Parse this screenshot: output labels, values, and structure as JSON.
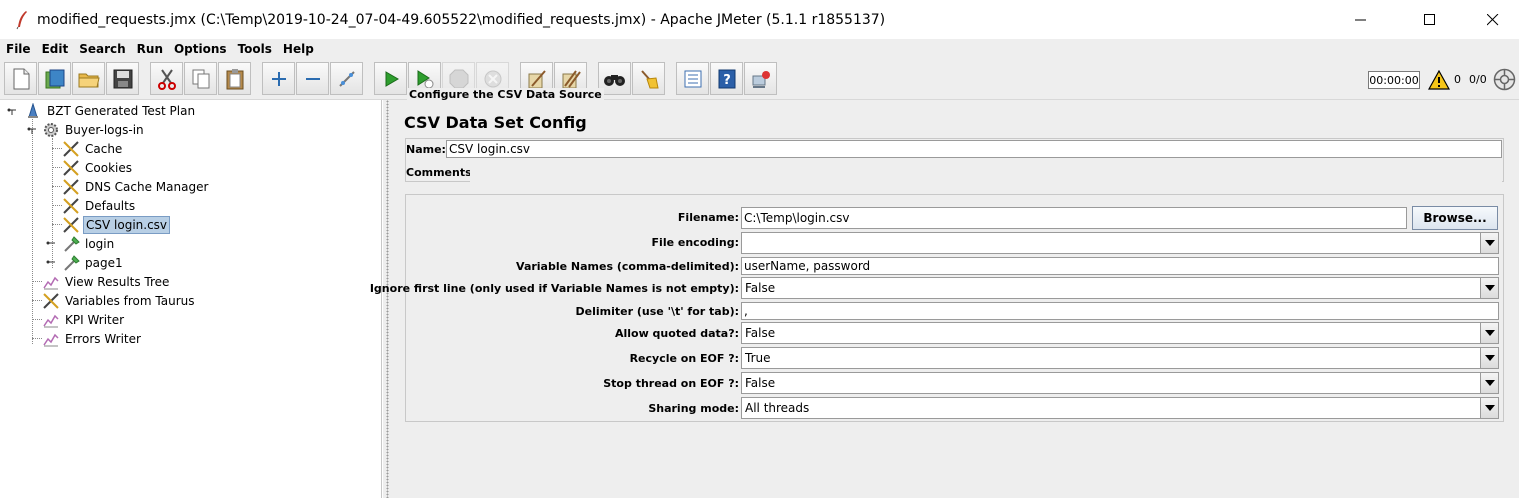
{
  "window": {
    "title": "modified_requests.jmx (C:\\Temp\\2019-10-24_07-04-49.605522\\modified_requests.jmx) - Apache JMeter (5.1.1 r1855137)",
    "icons": [
      "feather-icon",
      "minimize-icon",
      "maximize-icon",
      "close-icon"
    ]
  },
  "menu": {
    "file": "File",
    "edit": "Edit",
    "search": "Search",
    "run": "Run",
    "options": "Options",
    "tools": "Tools",
    "help": "Help"
  },
  "toolbar": {
    "buttons": [
      "new-icon",
      "templates-icon",
      "open-icon",
      "save-icon",
      "cut-icon",
      "copy-icon",
      "paste-icon",
      "expand-icon",
      "collapse-icon",
      "toggle-icon",
      "start-icon",
      "start-no-pauses-icon",
      "stop-icon",
      "shutdown-icon",
      "clear-icon",
      "clear-all-icon",
      "search-icon",
      "reset-search-icon",
      "function-helper-icon",
      "help-icon",
      "remote-icon"
    ],
    "timer": "00:00:00",
    "warning_count": "0",
    "threads": "0/0"
  },
  "tree": {
    "items": [
      {
        "label": "BZT Generated Test Plan",
        "icon": "test-plan-icon"
      },
      {
        "label": "Buyer-logs-in",
        "icon": "thread-group-icon"
      },
      {
        "label": "Cache",
        "icon": "config-element-icon"
      },
      {
        "label": "Cookies",
        "icon": "config-element-icon"
      },
      {
        "label": "DNS Cache Manager",
        "icon": "config-element-icon"
      },
      {
        "label": "Defaults",
        "icon": "config-element-icon"
      },
      {
        "label": "CSV login.csv",
        "icon": "config-element-icon",
        "selected": true
      },
      {
        "label": "login",
        "icon": "sampler-icon"
      },
      {
        "label": "page1",
        "icon": "sampler-icon"
      },
      {
        "label": "View Results Tree",
        "icon": "listener-icon"
      },
      {
        "label": "Variables from Taurus",
        "icon": "config-element-icon"
      },
      {
        "label": "KPI Writer",
        "icon": "listener-icon"
      },
      {
        "label": "Errors Writer",
        "icon": "listener-icon"
      }
    ]
  },
  "panel": {
    "title": "CSV Data Set Config",
    "name_label": "Name:",
    "name_value": "CSV login.csv",
    "comments_label": "Comments:",
    "comments_value": "",
    "section_title": "Configure the CSV Data Source",
    "filename_label": "Filename:",
    "filename_value": "C:\\Temp\\login.csv",
    "browse_label": "Browse...",
    "encoding_label": "File encoding:",
    "encoding_value": "",
    "varnames_label": "Variable Names (comma-delimited):",
    "varnames_value": "userName, password",
    "ignore_label": "Ignore first line (only used if Variable Names is not empty):",
    "ignore_value": "False",
    "delimiter_label": "Delimiter (use '\\t' for tab):",
    "delimiter_value": ",",
    "quoted_label": "Allow quoted data?:",
    "quoted_value": "False",
    "recycle_label": "Recycle on EOF ?:",
    "recycle_value": "True",
    "stopthread_label": "Stop thread on EOF ?:",
    "stopthread_value": "False",
    "sharing_label": "Sharing mode:",
    "sharing_value": "All threads"
  }
}
